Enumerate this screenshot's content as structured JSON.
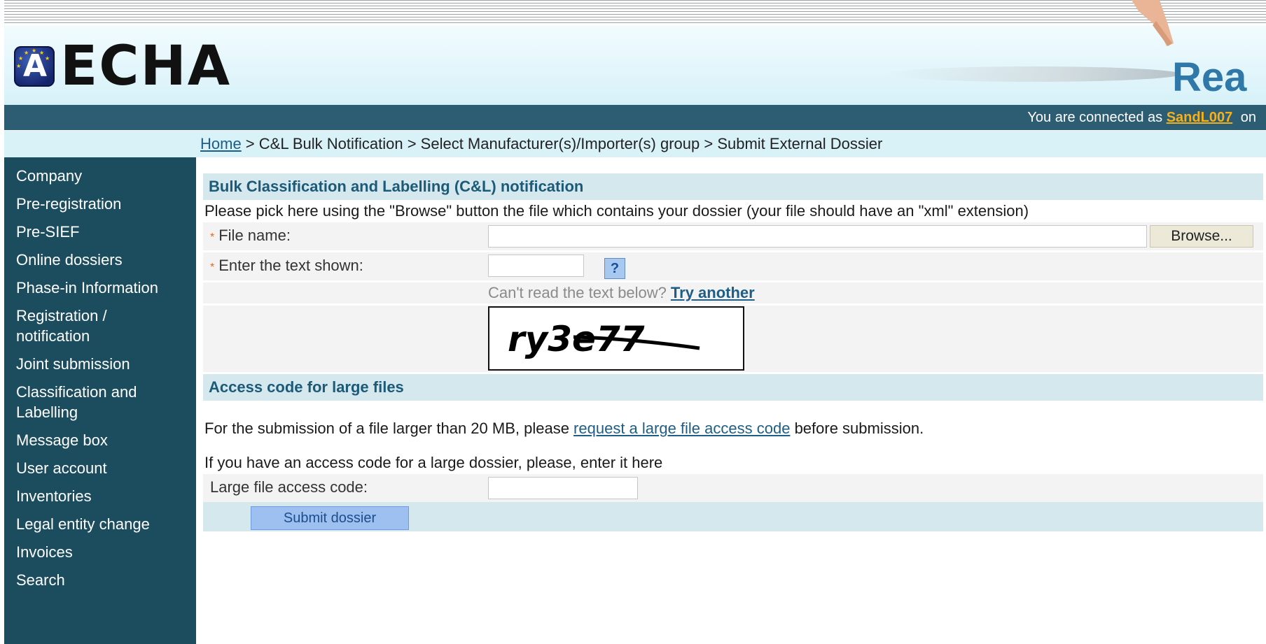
{
  "header": {
    "logo_text": "ECHA",
    "brand_text": "Rea",
    "connected_prefix": "You are connected as",
    "username": "SandL007",
    "connected_suffix": "on"
  },
  "breadcrumb": {
    "home": "Home",
    "rest": " > C&L Bulk Notification > Select Manufacturer(s)/Importer(s) group > Submit External Dossier"
  },
  "sidebar": {
    "items": [
      "Company",
      "Pre-registration",
      "Pre-SIEF",
      "Online dossiers",
      "Phase-in Information",
      "Registration / notification",
      "Joint submission",
      "Classification and Labelling",
      "Message box",
      "User account",
      "Inventories",
      "Legal entity change",
      "Invoices",
      "Search"
    ]
  },
  "form": {
    "title": "Bulk Classification and Labelling (C&L) notification",
    "instructions": "Please pick here using the \"Browse\" button the file which contains your dossier (your file should have an \"xml\" extension)",
    "required_marker": "*",
    "file_label": "File name:",
    "file_value": "",
    "browse_label": "Browse...",
    "captcha_label": "Enter the text shown:",
    "captcha_value": "",
    "help_label": "?",
    "captcha_prompt": "Can't read the text below?",
    "captcha_try_another": "Try another",
    "captcha_text": "ry3e77"
  },
  "access": {
    "title": "Access code for large files",
    "text_before": "For the submission of a file larger than 20 MB, please ",
    "link_text": "request a large file access code",
    "text_after": " before submission.",
    "enter_text": "If you have an access code for a large dossier, please, enter it here",
    "code_label": "Large file access code:",
    "code_value": "",
    "submit_label": "Submit dossier"
  }
}
